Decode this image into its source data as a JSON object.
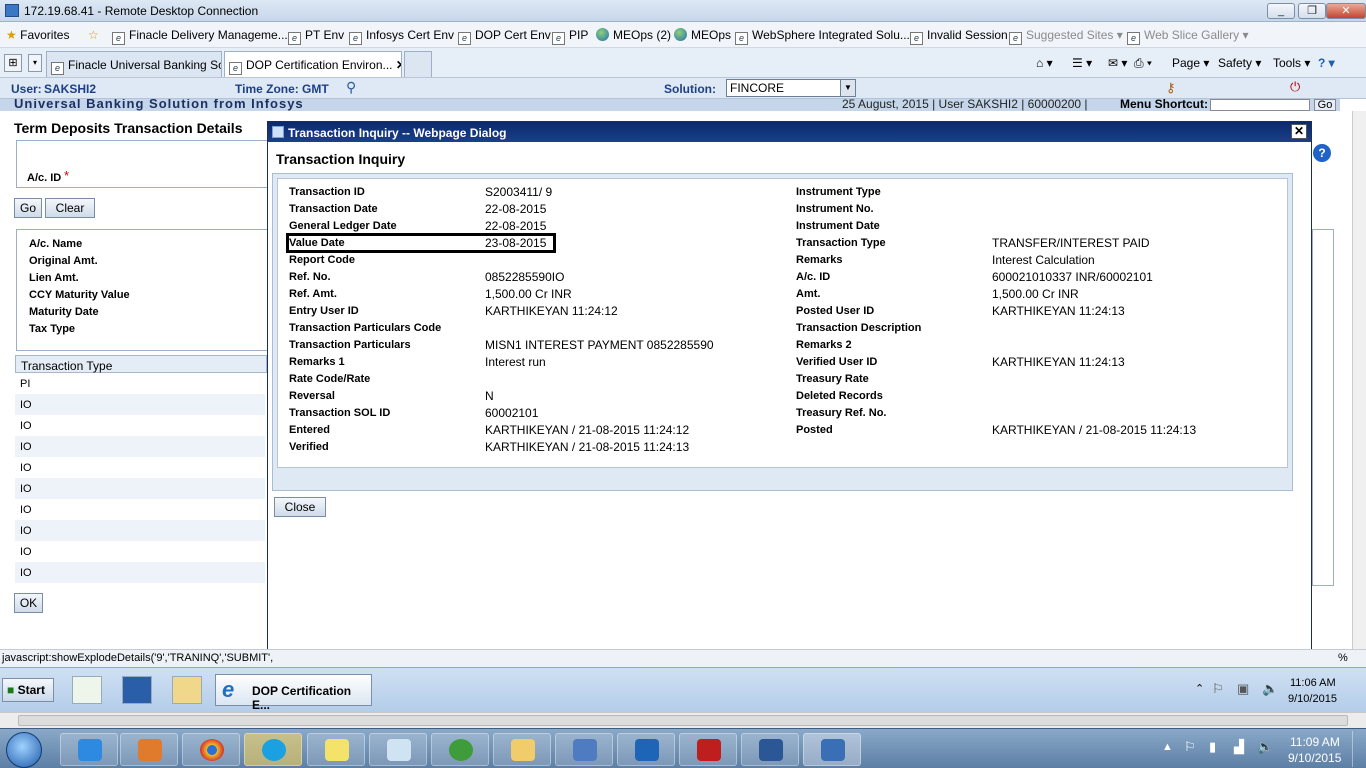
{
  "rdp": {
    "title": "172.19.68.41 - Remote Desktop Connection",
    "minimize": "_",
    "restore": "❐",
    "close": "✕"
  },
  "favorites": {
    "label": "Favorites",
    "items": [
      "Finacle Delivery Manageme...",
      "PT Env",
      "Infosys Cert Env",
      "DOP Cert Env",
      "PIP",
      "MEOps (2)",
      "MEOps",
      "WebSphere Integrated Solu...",
      "Invalid Session",
      "Suggested Sites",
      "Web Slice Gallery"
    ]
  },
  "tabs": [
    "Finacle Universal Banking Sol...",
    "DOP Certification Environ..."
  ],
  "ie_commands": {
    "page": "Page",
    "safety": "Safety",
    "tools": "Tools"
  },
  "header": {
    "user_label": "User:",
    "user_value": "SAKSHI2",
    "timezone_label": "Time Zone:",
    "timezone_value": "GMT",
    "solution_label": "Solution:",
    "solution_value": "FINCORE"
  },
  "subheader": {
    "brand": "Universal Banking Solution from Infosys",
    "session_info": "25 August, 2015 | User SAKSHI2 | 60000200 |",
    "menu_shortcut_label": "Menu Shortcut:",
    "go_label": "Go"
  },
  "background_page": {
    "title": "Term Deposits Transaction Details",
    "account_id_label": "A/c. ID",
    "required_mark": "*",
    "go_label": "Go",
    "clear_label": "Clear",
    "fields": [
      "A/c. Name",
      "Original Amt.",
      "Lien Amt.",
      "CCY Maturity Value",
      "Maturity Date",
      "Tax Type"
    ],
    "table_header": "Transaction Type",
    "table_rows": [
      "PI",
      "IO",
      "IO",
      "IO",
      "IO",
      "IO",
      "IO",
      "IO",
      "IO",
      "IO"
    ],
    "ok_label": "OK"
  },
  "dialog": {
    "window_title": "Transaction Inquiry -- Webpage Dialog",
    "heading": "Transaction Inquiry",
    "left_fields": [
      {
        "label": "Transaction ID",
        "value": "S2003411/ 9"
      },
      {
        "label": "Transaction Date",
        "value": "22-08-2015"
      },
      {
        "label": "General Ledger Date",
        "value": "22-08-2015"
      },
      {
        "label": "Value Date",
        "value": "23-08-2015"
      },
      {
        "label": "Report Code",
        "value": ""
      },
      {
        "label": "Ref. No.",
        "value": "0852285590IO"
      },
      {
        "label": "Ref. Amt.",
        "value": "1,500.00 Cr INR"
      },
      {
        "label": "Entry User ID",
        "value": "KARTHIKEYAN 11:24:12"
      },
      {
        "label": "Transaction Particulars Code",
        "value": ""
      },
      {
        "label": "Transaction Particulars",
        "value": "MISN1 INTEREST PAYMENT 0852285590"
      },
      {
        "label": "Remarks 1",
        "value": "Interest run"
      },
      {
        "label": "Rate Code/Rate",
        "value": ""
      },
      {
        "label": "Reversal",
        "value": "N"
      },
      {
        "label": "Transaction SOL ID",
        "value": "60002101"
      },
      {
        "label": "Entered",
        "value": "KARTHIKEYAN / 21-08-2015 11:24:12"
      },
      {
        "label": "Verified",
        "value": "KARTHIKEYAN / 21-08-2015 11:24:13"
      }
    ],
    "right_fields": [
      {
        "label": "Instrument Type",
        "value": ""
      },
      {
        "label": "Instrument No.",
        "value": ""
      },
      {
        "label": "Instrument Date",
        "value": ""
      },
      {
        "label": "Transaction Type",
        "value": "TRANSFER/INTEREST PAID"
      },
      {
        "label": "Remarks",
        "value": "Interest Calculation"
      },
      {
        "label": "A/c. ID",
        "value": "600021010337 INR/60002101"
      },
      {
        "label": "Amt.",
        "value": "1,500.00 Cr INR"
      },
      {
        "label": "Posted User ID",
        "value": "KARTHIKEYAN 11:24:13"
      },
      {
        "label": "Transaction Description",
        "value": ""
      },
      {
        "label": "Remarks 2",
        "value": ""
      },
      {
        "label": "Verified User ID",
        "value": "KARTHIKEYAN 11:24:13"
      },
      {
        "label": "Treasury Rate",
        "value": ""
      },
      {
        "label": "Deleted Records",
        "value": ""
      },
      {
        "label": "Treasury Ref. No.",
        "value": ""
      },
      {
        "label": "Posted",
        "value": "KARTHIKEYAN / 21-08-2015 11:24:13"
      }
    ],
    "close_label": "Close"
  },
  "status_bar": {
    "text": "javascript:showExplodeDetails('9','TRANINQ','SUBMIT',",
    "zoom": "%"
  },
  "vm_taskbar": {
    "start_label": "Start",
    "task_label": "DOP Certification E...",
    "time": "11:06 AM",
    "date": "9/10/2015"
  },
  "host_taskbar": {
    "time": "11:09 AM",
    "date": "9/10/2015"
  },
  "colors": {
    "dialog_title_bg": "#0a2a6b",
    "label_blue": "#1d3f86",
    "panel_bg": "#dfe9f4"
  }
}
